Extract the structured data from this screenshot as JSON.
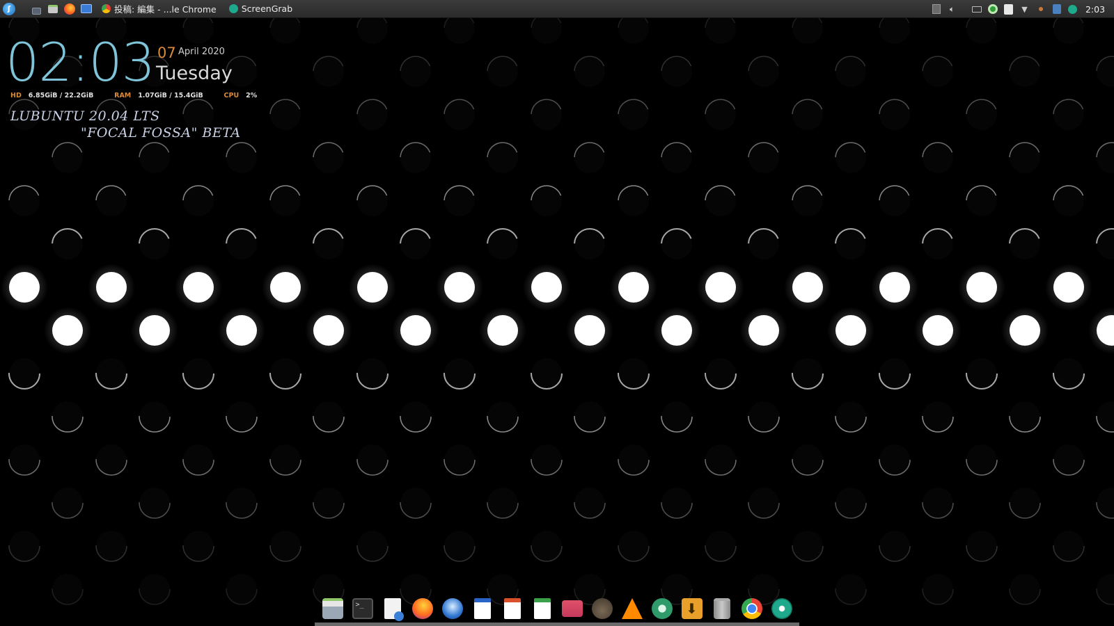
{
  "panel": {
    "task_buttons": [
      {
        "label": "投稿: 編集 - ...le Chrome",
        "icon": "chrome-icon"
      },
      {
        "label": "ScreenGrab",
        "icon": "screengrab-icon"
      }
    ],
    "clock": "2:03"
  },
  "conky": {
    "time": "02:03",
    "day": "07",
    "month_year": "April 2020",
    "weekday": "Tuesday",
    "hd_label": "HD",
    "hd_value": "6.85GiB / 22.2GiB",
    "ram_label": "RAM",
    "ram_value": "1.07GiB / 15.4GiB",
    "cpu_label": "CPU",
    "cpu_value": "2%",
    "os_name": "LUBUNTU 20.04 LTS",
    "os_codename": "\"FOCAL FOSSA\" BETA"
  },
  "dock": {
    "items": [
      "file-manager-icon",
      "terminal-icon",
      "text-editor-icon",
      "firefox-icon",
      "thunderbird-icon",
      "writer-icon",
      "impress-icon",
      "calc-icon",
      "image-viewer-icon",
      "gimp-icon",
      "vlc-icon",
      "settings-icon",
      "downloader-icon",
      "trash-icon",
      "chrome-icon",
      "screengrab-icon"
    ]
  },
  "colors": {
    "accent_time": "#7fc4d8",
    "accent_orange": "#d98a3a",
    "panel_bg": "#2f2f2f"
  }
}
